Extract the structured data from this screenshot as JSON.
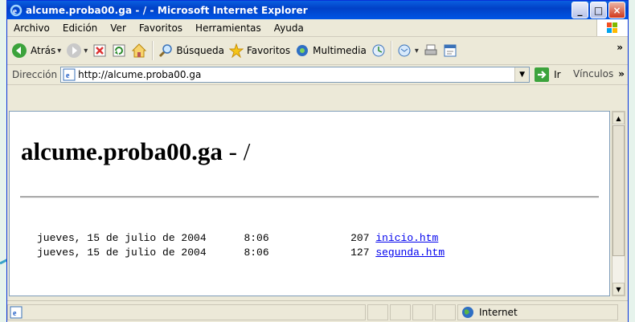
{
  "window": {
    "title": "alcume.proba00.ga - / - Microsoft Internet Explorer",
    "controls": [
      "_",
      "□",
      "×"
    ]
  },
  "menu": [
    {
      "label": "Archivo"
    },
    {
      "label": "Edición"
    },
    {
      "label": "Ver"
    },
    {
      "label": "Favoritos"
    },
    {
      "label": "Herramientas"
    },
    {
      "label": "Ayuda"
    }
  ],
  "toolbar": {
    "back_label": "Atrás",
    "search_label": "Búsqueda",
    "favorites_label": "Favoritos",
    "media_label": "Multimedia",
    "overflow": "»"
  },
  "address": {
    "label": "Dirección",
    "url": "http://alcume.proba00.ga",
    "go_label": "Ir",
    "links_label": "Vínculos",
    "links_overflow": "»"
  },
  "page": {
    "heading_bold": "alcume.proba00.ga",
    "heading_rest": " - /",
    "files": [
      {
        "date": "jueves, 15 de julio de 2004",
        "time": "8:06",
        "size": "207",
        "name": "inicio.htm"
      },
      {
        "date": "jueves, 15 de julio de 2004",
        "time": "8:06",
        "size": "127",
        "name": "segunda.htm"
      }
    ]
  },
  "status": {
    "zone": "Internet"
  },
  "colors": {
    "titlebar": "#0a5fe0",
    "chrome": "#ece9d8",
    "link": "#0000ee",
    "background": "#e6f3ec"
  }
}
